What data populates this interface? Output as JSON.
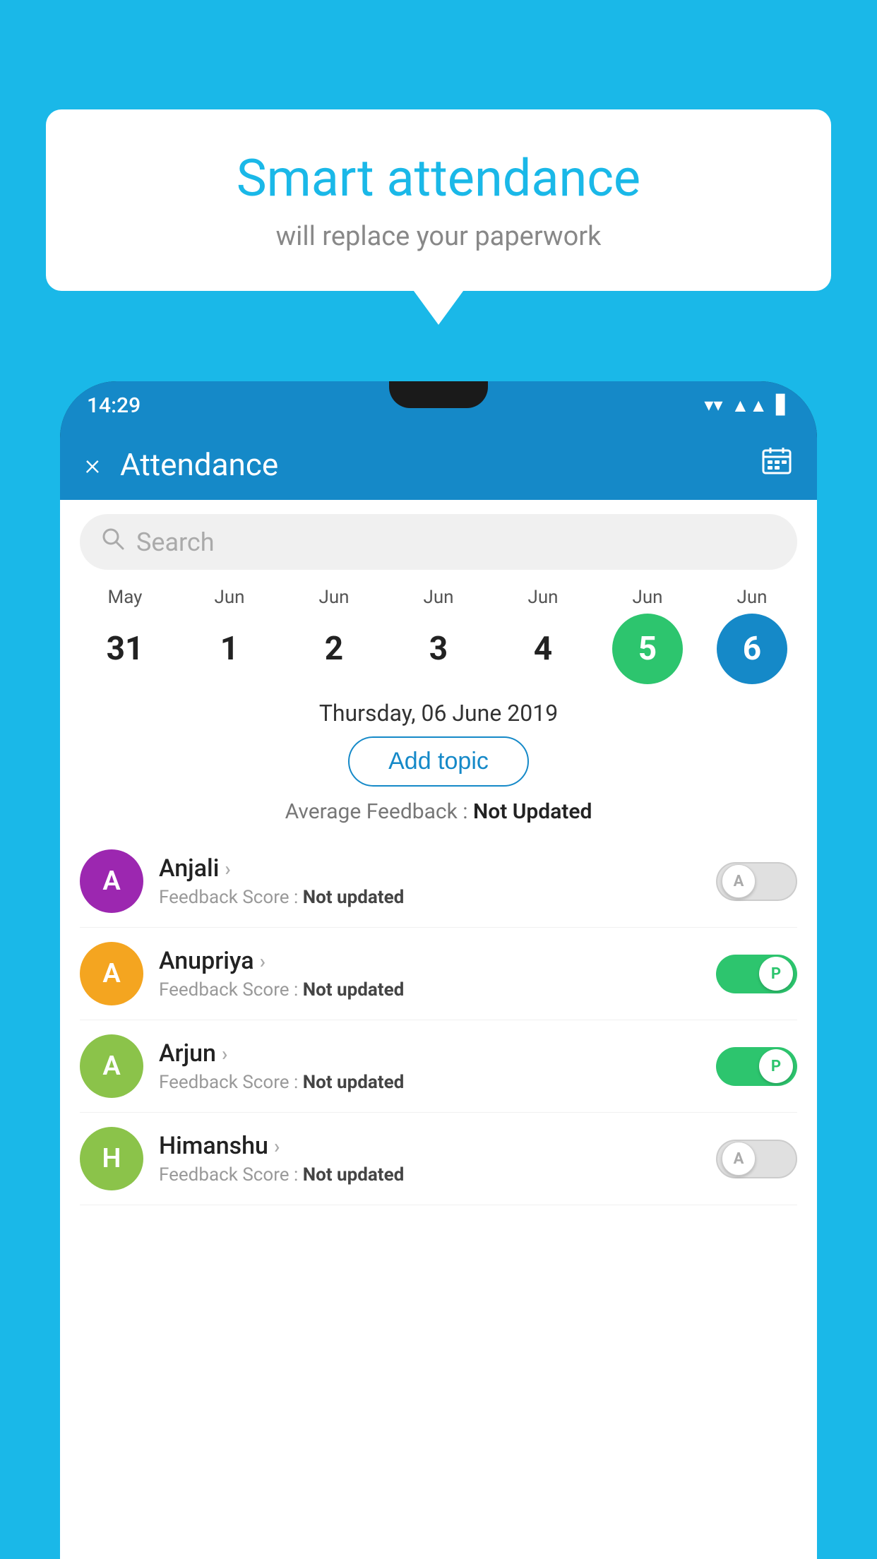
{
  "background_color": "#1ab8e8",
  "speech_bubble": {
    "title": "Smart attendance",
    "subtitle": "will replace your paperwork"
  },
  "status_bar": {
    "time": "14:29",
    "icons": [
      "▼▲",
      "▲",
      "▋"
    ]
  },
  "app_bar": {
    "title": "Attendance",
    "close_label": "×",
    "calendar_icon": "📅"
  },
  "search": {
    "placeholder": "Search"
  },
  "calendar": {
    "days": [
      {
        "month": "May",
        "date": "31",
        "style": "normal"
      },
      {
        "month": "Jun",
        "date": "1",
        "style": "normal"
      },
      {
        "month": "Jun",
        "date": "2",
        "style": "normal"
      },
      {
        "month": "Jun",
        "date": "3",
        "style": "normal"
      },
      {
        "month": "Jun",
        "date": "4",
        "style": "normal"
      },
      {
        "month": "Jun",
        "date": "5",
        "style": "today"
      },
      {
        "month": "Jun",
        "date": "6",
        "style": "selected"
      }
    ]
  },
  "selected_date": "Thursday, 06 June 2019",
  "add_topic_label": "Add topic",
  "average_feedback": {
    "label": "Average Feedback : ",
    "value": "Not Updated"
  },
  "students": [
    {
      "name": "Anjali",
      "avatar_letter": "A",
      "avatar_color": "#9c27b0",
      "feedback_label": "Feedback Score : ",
      "feedback_value": "Not updated",
      "toggle": "off",
      "toggle_label": "A"
    },
    {
      "name": "Anupriya",
      "avatar_letter": "A",
      "avatar_color": "#f4a520",
      "feedback_label": "Feedback Score : ",
      "feedback_value": "Not updated",
      "toggle": "on",
      "toggle_label": "P"
    },
    {
      "name": "Arjun",
      "avatar_letter": "A",
      "avatar_color": "#8bc34a",
      "feedback_label": "Feedback Score : ",
      "feedback_value": "Not updated",
      "toggle": "on",
      "toggle_label": "P"
    },
    {
      "name": "Himanshu",
      "avatar_letter": "H",
      "avatar_color": "#8bc34a",
      "feedback_label": "Feedback Score : ",
      "feedback_value": "Not updated",
      "toggle": "off",
      "toggle_label": "A"
    }
  ]
}
